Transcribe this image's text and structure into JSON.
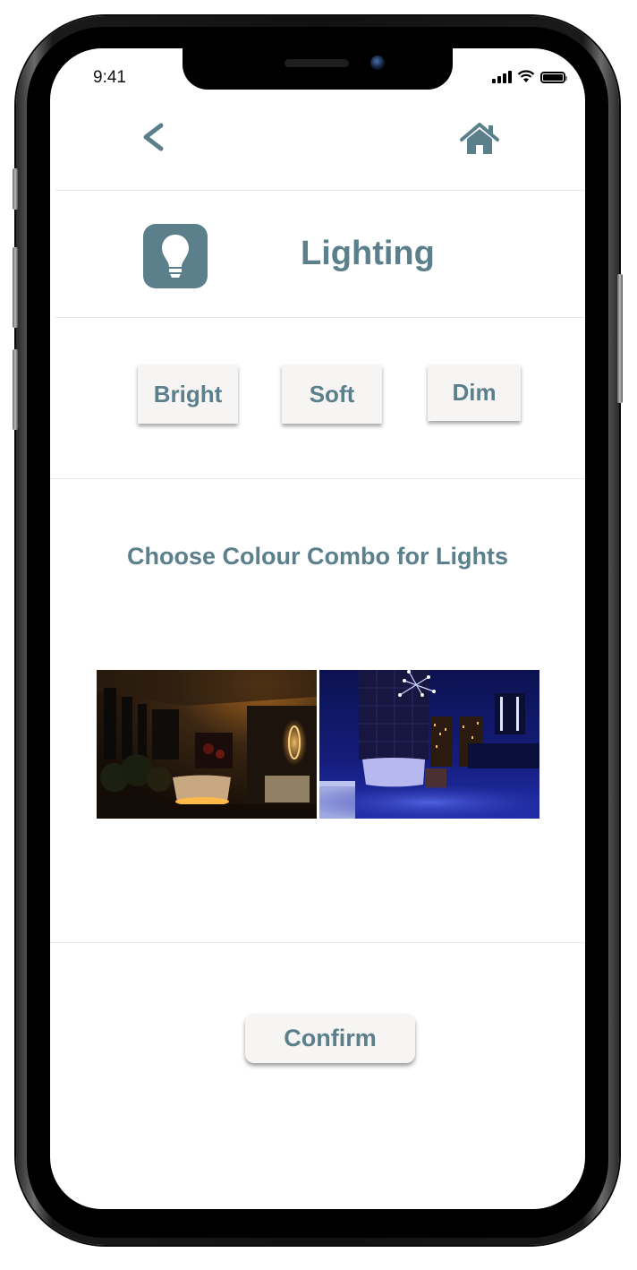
{
  "status_bar": {
    "time": "9:41"
  },
  "nav": {
    "back_icon": "chevron-left-icon",
    "home_icon": "home-icon"
  },
  "header": {
    "icon": "lightbulb-icon",
    "title": "Lighting"
  },
  "modes": [
    {
      "label": "Bright"
    },
    {
      "label": "Soft"
    },
    {
      "label": "Dim"
    }
  ],
  "colour_section": {
    "heading": "Choose Colour Combo for Lights",
    "options": [
      {
        "name": "warm-amber",
        "description": "Warm amber lit bathroom"
      },
      {
        "name": "cool-blue",
        "description": "Cool blue lit bathroom"
      }
    ]
  },
  "confirm_label": "Confirm",
  "colors": {
    "accent": "#5b808b",
    "button_bg": "#f7f5f3"
  }
}
